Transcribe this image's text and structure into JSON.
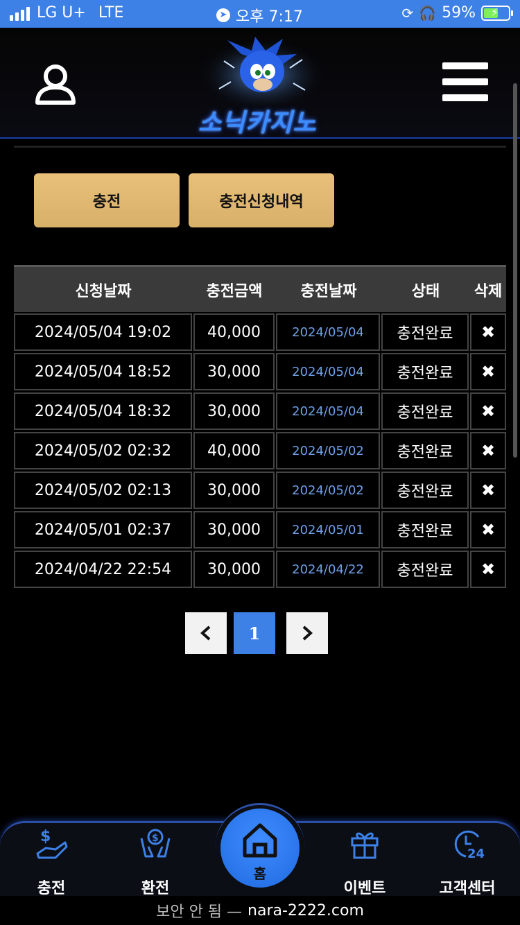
{
  "status_bar": {
    "carrier": "LG U+",
    "network": "LTE",
    "time": "오후 7:17",
    "battery": "59%"
  },
  "header": {
    "logo_text": "소닉카지노"
  },
  "tabs": {
    "charge": "충전",
    "charge_history": "충전신청내역"
  },
  "table": {
    "columns": [
      "신청날짜",
      "충전금액",
      "충전날짜",
      "상태",
      "삭제"
    ],
    "rows": [
      {
        "request_date": "2024/05/04 19:02",
        "amount": "40,000",
        "charge_date": "2024/05/04",
        "status": "충전완료",
        "delete": "✖"
      },
      {
        "request_date": "2024/05/04 18:52",
        "amount": "30,000",
        "charge_date": "2024/05/04",
        "status": "충전완료",
        "delete": "✖"
      },
      {
        "request_date": "2024/05/04 18:32",
        "amount": "30,000",
        "charge_date": "2024/05/04",
        "status": "충전완료",
        "delete": "✖"
      },
      {
        "request_date": "2024/05/02 02:32",
        "amount": "40,000",
        "charge_date": "2024/05/02",
        "status": "충전완료",
        "delete": "✖"
      },
      {
        "request_date": "2024/05/02 02:13",
        "amount": "30,000",
        "charge_date": "2024/05/02",
        "status": "충전완료",
        "delete": "✖"
      },
      {
        "request_date": "2024/05/01 02:37",
        "amount": "30,000",
        "charge_date": "2024/05/01",
        "status": "충전완료",
        "delete": "✖"
      },
      {
        "request_date": "2024/04/22 22:54",
        "amount": "30,000",
        "charge_date": "2024/04/22",
        "status": "충전완료",
        "delete": "✖"
      }
    ]
  },
  "pagination": {
    "prev": "‹",
    "current": "1",
    "next": "›"
  },
  "bottom_nav": {
    "charge": "충전",
    "exchange": "환전",
    "home": "홈",
    "event": "이벤트",
    "support": "고객센터"
  },
  "url_bar": {
    "security": "보안 안 됨 —",
    "domain": "nara-2222.com"
  },
  "colors": {
    "status_bar": "#3d80e6",
    "tab_button": "#e0b774",
    "accent_blue": "#3d80e6",
    "charge_date_text": "#6fa0e8"
  }
}
